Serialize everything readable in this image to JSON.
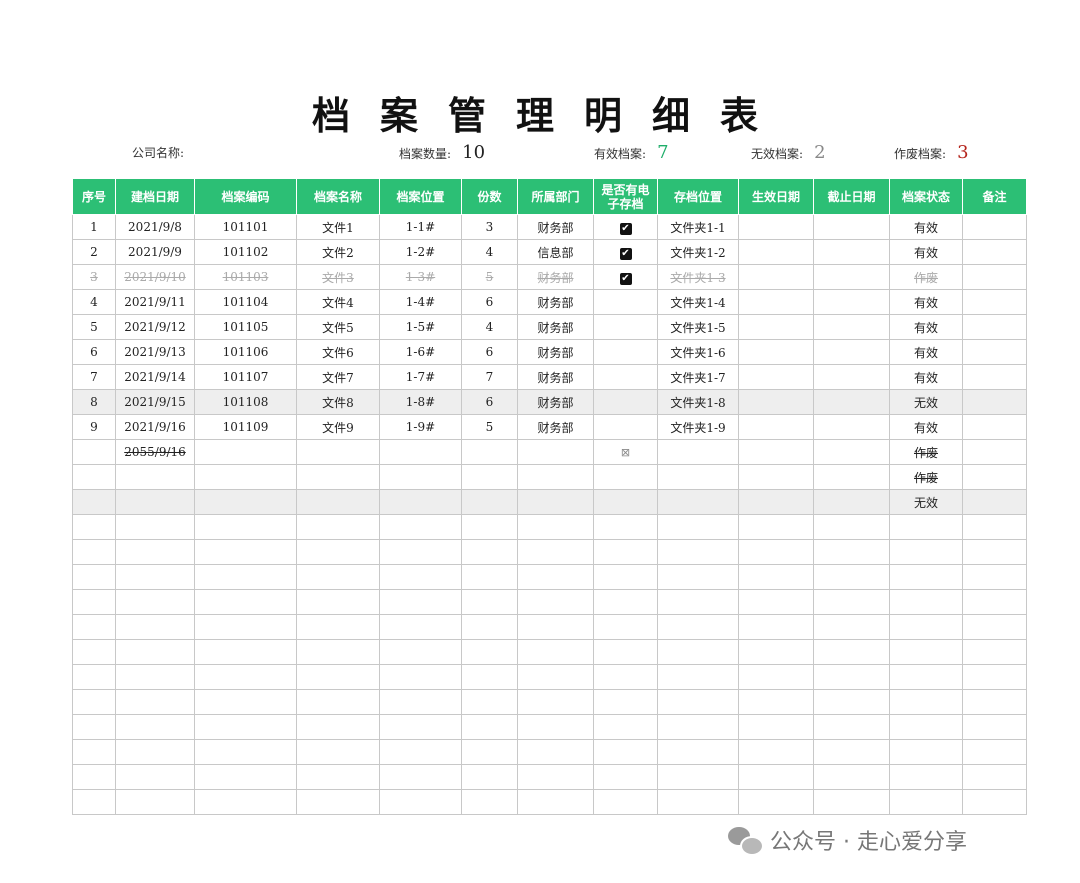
{
  "title": "档案管理明细表",
  "summary": {
    "company_label": "公司名称:",
    "count_label": "档案数量:",
    "count_value": "10",
    "valid_label": "有效档案:",
    "valid_value": "7",
    "invalid_label": "无效档案:",
    "invalid_value": "2",
    "void_label": "作废档案:",
    "void_value": "3"
  },
  "columns": [
    "序号",
    "建档日期",
    "档案编码",
    "档案名称",
    "档案位置",
    "份数",
    "所属部门",
    "是否有电子存档",
    "存档位置",
    "生效日期",
    "截止日期",
    "档案状态",
    "备注"
  ],
  "rows": [
    {
      "no": "1",
      "date": "2021/9/8",
      "code": "101101",
      "name": "文件1",
      "loc": "1-1#",
      "copies": "3",
      "dept": "财务部",
      "electronic": "checked",
      "archive": "文件夹1-1",
      "effective": "",
      "expiry": "",
      "status": "有效",
      "note": "",
      "style": ""
    },
    {
      "no": "2",
      "date": "2021/9/9",
      "code": "101102",
      "name": "文件2",
      "loc": "1-2#",
      "copies": "4",
      "dept": "信息部",
      "electronic": "checked",
      "archive": "文件夹1-2",
      "effective": "",
      "expiry": "",
      "status": "有效",
      "note": "",
      "style": ""
    },
    {
      "no": "3",
      "date": "2021/9/10",
      "code": "101103",
      "name": "文件3",
      "loc": "1-3#",
      "copies": "5",
      "dept": "财务部",
      "electronic": "checked",
      "archive": "文件夹1-3",
      "effective": "",
      "expiry": "",
      "status": "作废",
      "note": "",
      "style": "strike"
    },
    {
      "no": "4",
      "date": "2021/9/11",
      "code": "101104",
      "name": "文件4",
      "loc": "1-4#",
      "copies": "6",
      "dept": "财务部",
      "electronic": "",
      "archive": "文件夹1-4",
      "effective": "",
      "expiry": "",
      "status": "有效",
      "note": "",
      "style": ""
    },
    {
      "no": "5",
      "date": "2021/9/12",
      "code": "101105",
      "name": "文件5",
      "loc": "1-5#",
      "copies": "4",
      "dept": "财务部",
      "electronic": "",
      "archive": "文件夹1-5",
      "effective": "",
      "expiry": "",
      "status": "有效",
      "note": "",
      "style": ""
    },
    {
      "no": "6",
      "date": "2021/9/13",
      "code": "101106",
      "name": "文件6",
      "loc": "1-6#",
      "copies": "6",
      "dept": "财务部",
      "electronic": "",
      "archive": "文件夹1-6",
      "effective": "",
      "expiry": "",
      "status": "有效",
      "note": "",
      "style": ""
    },
    {
      "no": "7",
      "date": "2021/9/14",
      "code": "101107",
      "name": "文件7",
      "loc": "1-7#",
      "copies": "7",
      "dept": "财务部",
      "electronic": "",
      "archive": "文件夹1-7",
      "effective": "",
      "expiry": "",
      "status": "有效",
      "note": "",
      "style": ""
    },
    {
      "no": "8",
      "date": "2021/9/15",
      "code": "101108",
      "name": "文件8",
      "loc": "1-8#",
      "copies": "6",
      "dept": "财务部",
      "electronic": "",
      "archive": "文件夹1-8",
      "effective": "",
      "expiry": "",
      "status": "无效",
      "note": "",
      "style": "gray"
    },
    {
      "no": "9",
      "date": "2021/9/16",
      "code": "101109",
      "name": "文件9",
      "loc": "1-9#",
      "copies": "5",
      "dept": "财务部",
      "electronic": "",
      "archive": "文件夹1-9",
      "effective": "",
      "expiry": "",
      "status": "有效",
      "note": "",
      "style": ""
    },
    {
      "no": "",
      "date": "2055/9/16",
      "code": "",
      "name": "",
      "loc": "",
      "copies": "",
      "dept": "",
      "electronic": "unchecked",
      "archive": "",
      "effective": "",
      "expiry": "",
      "status": "作废",
      "note": "",
      "style": "partial"
    },
    {
      "no": "",
      "date": "",
      "code": "",
      "name": "",
      "loc": "",
      "copies": "",
      "dept": "",
      "electronic": "",
      "archive": "",
      "effective": "",
      "expiry": "",
      "status": "作废",
      "note": "",
      "style": "partial"
    },
    {
      "no": "",
      "date": "",
      "code": "",
      "name": "",
      "loc": "",
      "copies": "",
      "dept": "",
      "electronic": "",
      "archive": "",
      "effective": "",
      "expiry": "",
      "status": "无效",
      "note": "",
      "style": "gray"
    }
  ],
  "empty_rows": 12,
  "checkbox_icons": {
    "checked": "✔",
    "unchecked": "⊠"
  },
  "watermark": {
    "text": "公众号 · 走心爱分享",
    "icon": "wechat-icon"
  },
  "colors": {
    "header_green": "#2cbf75",
    "valid_green": "#1fae6a",
    "void_red": "#b5261e",
    "invalid_gray": "#888888",
    "row_gray": "#eeeeee"
  }
}
